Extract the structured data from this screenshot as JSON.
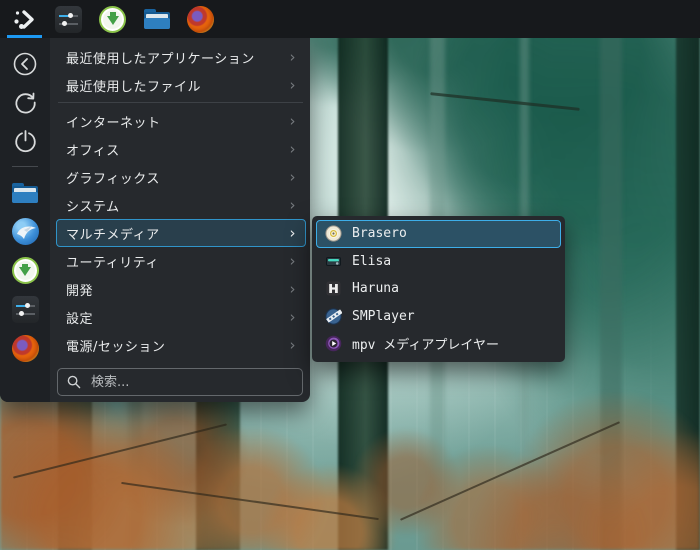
{
  "colors": {
    "accent": "#3daee9",
    "taskbar_bg": "#17191c",
    "panel_bg": "#26292d",
    "sidebar_bg": "#1e2125",
    "text": "#e9ebec",
    "active_underline": "#1d99f3"
  },
  "icons": {
    "chevron_right": "›"
  },
  "taskbar": {
    "items": [
      {
        "name": "app-launcher",
        "icon": "kickoff-icon",
        "active": true
      },
      {
        "name": "system-settings",
        "icon": "sliders-icon"
      },
      {
        "name": "software-updater",
        "icon": "updater-icon"
      },
      {
        "name": "file-manager",
        "icon": "folder-icon"
      },
      {
        "name": "firefox",
        "icon": "firefox-icon"
      }
    ]
  },
  "launcher": {
    "sidebar": {
      "items": [
        {
          "name": "back",
          "icon": "back-icon"
        },
        {
          "name": "restart",
          "icon": "restart-icon"
        },
        {
          "name": "shutdown",
          "icon": "power-icon"
        },
        {
          "name": "file-manager",
          "icon": "folder-icon"
        },
        {
          "name": "falkon",
          "icon": "falkon-icon"
        },
        {
          "name": "software-updater",
          "icon": "updater-icon"
        },
        {
          "name": "system-settings",
          "icon": "sliders-icon"
        },
        {
          "name": "firefox",
          "icon": "firefox-icon"
        }
      ]
    },
    "menu": {
      "recent": [
        {
          "label": "最近使用したアプリケーション"
        },
        {
          "label": "最近使用したファイル"
        }
      ],
      "categories": [
        {
          "label": "インターネット"
        },
        {
          "label": "オフィス"
        },
        {
          "label": "グラフィックス"
        },
        {
          "label": "システム"
        },
        {
          "label": "マルチメディア",
          "selected": true
        },
        {
          "label": "ユーティリティ"
        },
        {
          "label": "開発"
        },
        {
          "label": "設定"
        },
        {
          "label": "電源/セッション"
        }
      ],
      "search": {
        "placeholder": "検索..."
      }
    },
    "submenu": {
      "items": [
        {
          "label": "Brasero",
          "icon": "brasero-icon",
          "selected": true
        },
        {
          "label": "Elisa",
          "icon": "elisa-icon"
        },
        {
          "label": "Haruna",
          "icon": "haruna-icon"
        },
        {
          "label": "SMPlayer",
          "icon": "smplayer-icon"
        },
        {
          "label": "mpv メディアプレイヤー",
          "icon": "mpv-icon"
        }
      ]
    }
  }
}
